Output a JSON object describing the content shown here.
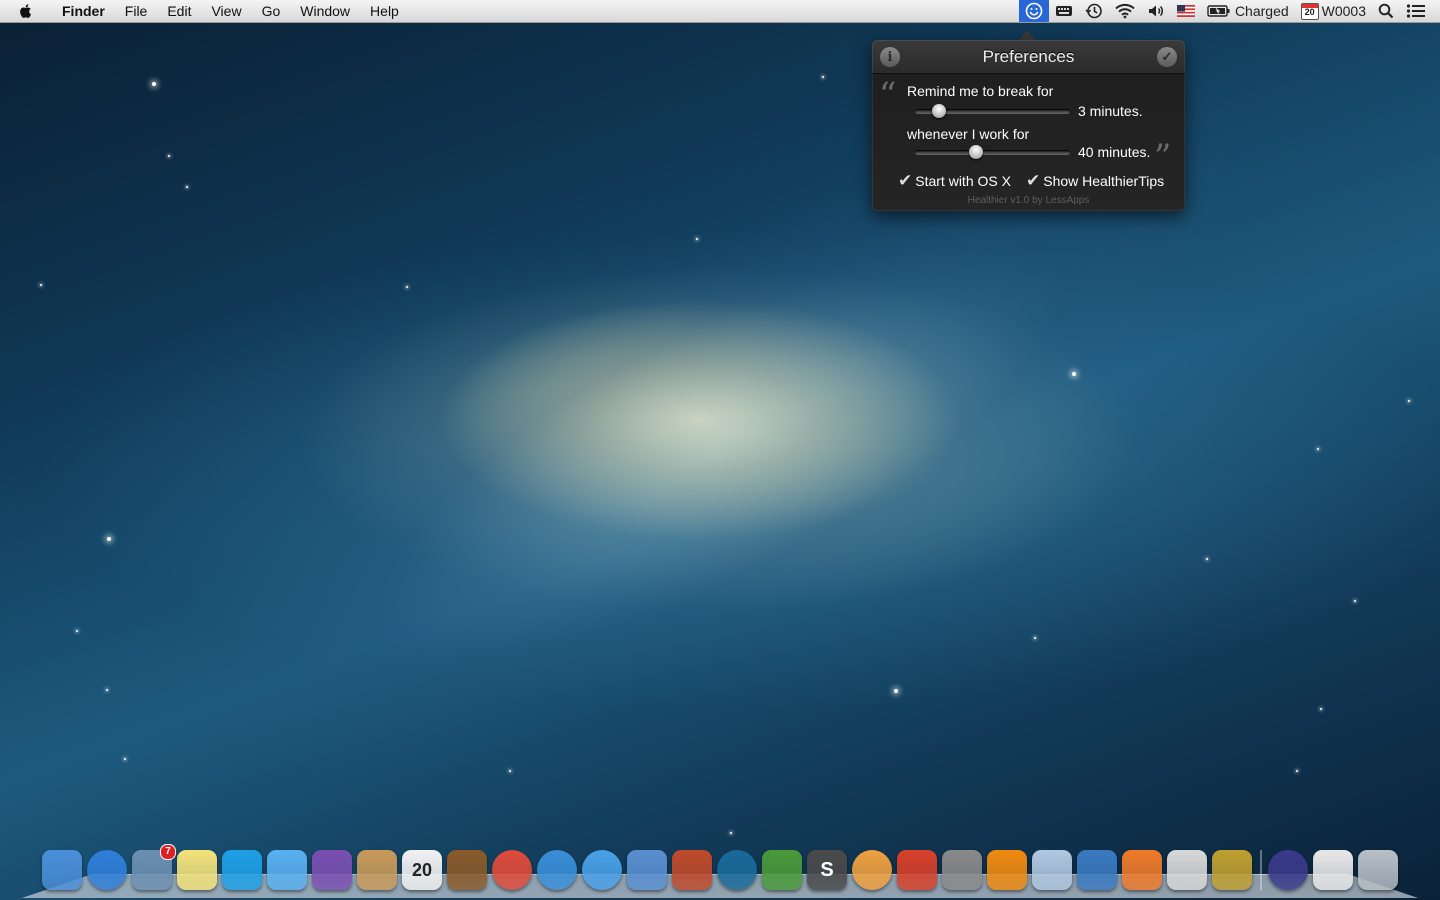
{
  "menubar": {
    "app_name": "Finder",
    "menus": [
      "File",
      "Edit",
      "View",
      "Go",
      "Window",
      "Help"
    ],
    "status": {
      "battery_text": "Charged",
      "calendar_day": "20",
      "week_label": "W0003",
      "icons": [
        "healthier-icon",
        "keyboard-icon",
        "time-machine-icon",
        "wifi-icon",
        "volume-icon",
        "us-flag-icon",
        "battery-icon",
        "calendar-icon",
        "spotlight-icon",
        "notification-center-icon"
      ]
    }
  },
  "popover": {
    "title": "Preferences",
    "break_label": "Remind me to break for",
    "break_value": "3 minutes.",
    "break_fraction": 0.12,
    "work_label": "whenever I work for",
    "work_value": "40 minutes.",
    "work_fraction": 0.38,
    "start_with_os_label": "Start with OS X",
    "start_with_os_checked": true,
    "show_tips_label": "Show HealthierTips",
    "show_tips_checked": true,
    "footer": "Healthier v1.0 by LessApps"
  },
  "dock": {
    "items": [
      {
        "name": "finder",
        "color": "#4a8fd8"
      },
      {
        "name": "app-store",
        "color": "#2f7ed8"
      },
      {
        "name": "mail",
        "color": "#6c8fb0",
        "badge": "7"
      },
      {
        "name": "stickies",
        "color": "#f3e27a"
      },
      {
        "name": "skype",
        "color": "#1ea0e6"
      },
      {
        "name": "messages",
        "color": "#5ab0f0"
      },
      {
        "name": "wizard",
        "color": "#7a4fb0"
      },
      {
        "name": "contacts",
        "color": "#c99a5a"
      },
      {
        "name": "calendar",
        "color": "#f2f2f2",
        "label": "20"
      },
      {
        "name": "photo-booth",
        "color": "#8a5a2a"
      },
      {
        "name": "chrome",
        "color": "#e04a3a"
      },
      {
        "name": "safari",
        "color": "#3a8fd8"
      },
      {
        "name": "itunes",
        "color": "#4aa0e8"
      },
      {
        "name": "xcode",
        "color": "#5a8fd0"
      },
      {
        "name": "sequel",
        "color": "#c04a2a"
      },
      {
        "name": "sourcetree",
        "color": "#1a6a9a"
      },
      {
        "name": "textwrangler",
        "color": "#4a9a3a"
      },
      {
        "name": "sublime-text",
        "color": "#4a4a4a",
        "label": "S"
      },
      {
        "name": "globe-app",
        "color": "#f0a040"
      },
      {
        "name": "wunderlist",
        "color": "#d8402a"
      },
      {
        "name": "system-preferences",
        "color": "#8a8a8a"
      },
      {
        "name": "vlc",
        "color": "#f08a10"
      },
      {
        "name": "preview",
        "color": "#b0c8e0"
      },
      {
        "name": "virtualbox",
        "color": "#3a7ac0"
      },
      {
        "name": "xampp",
        "color": "#f07a2a"
      },
      {
        "name": "utilities",
        "color": "#d8d8d8"
      },
      {
        "name": "forklift",
        "color": "#c0a030"
      },
      {
        "name": "eclipse",
        "color": "#3a3a8a"
      },
      {
        "name": "documents",
        "color": "#e8e8e8"
      },
      {
        "name": "trash",
        "color": "#b8c0c8"
      }
    ]
  }
}
